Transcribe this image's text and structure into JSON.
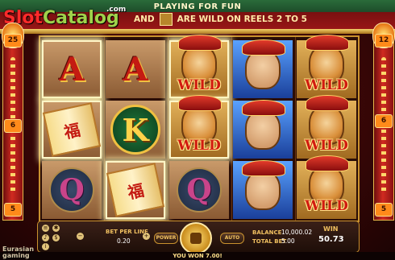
{
  "game": {
    "title": "PLAYING FOR FUN",
    "banner_prefix": "AND",
    "banner_suffix": "ARE WILD ON REELS 2 TO 5",
    "logo": {
      "part1": "Slot",
      "part2": "Catalog",
      "suffix": ".com"
    },
    "brand": {
      "line1": "Eurasian",
      "line2": "gaming"
    }
  },
  "lines": {
    "left_top": "25",
    "left_mid": "6",
    "left_bottom": "5",
    "right_top": "12",
    "right_mid": "6",
    "right_bottom": "5"
  },
  "reels": [
    {
      "symbols": [
        "A",
        "福 scroll",
        "Q"
      ]
    },
    {
      "symbols": [
        "A",
        "K",
        "福 scroll"
      ]
    },
    {
      "symbols": [
        "Monkey WILD",
        "Monkey WILD",
        "Q"
      ]
    },
    {
      "symbols": [
        "Tang Monk",
        "Tang Monk",
        "Tang Monk"
      ]
    },
    {
      "symbols": [
        "Monkey WILD",
        "Monkey WILD",
        "Monkey WILD"
      ]
    }
  ],
  "symbols": {
    "a": "A",
    "q": "Q",
    "k": "K",
    "fu": "福",
    "wild": "WILD"
  },
  "panel": {
    "bet_per_line_label": "BET PER LINE",
    "bet_per_line_value": "0.20",
    "power_label": "POWER",
    "auto_label": "AUTO",
    "balance_label": "BALANCE",
    "balance_value": "10,000.02",
    "total_bet_label": "TOTAL BET",
    "total_bet_value": "5.00",
    "win_label": "WIN",
    "win_value": "50.73"
  },
  "footer": {
    "won_text": "YOU WON 7.00!"
  },
  "colors": {
    "accent_gold": "#c9922e",
    "wild_red": "#d11b10",
    "reel_blue": "#1a3f9a"
  }
}
